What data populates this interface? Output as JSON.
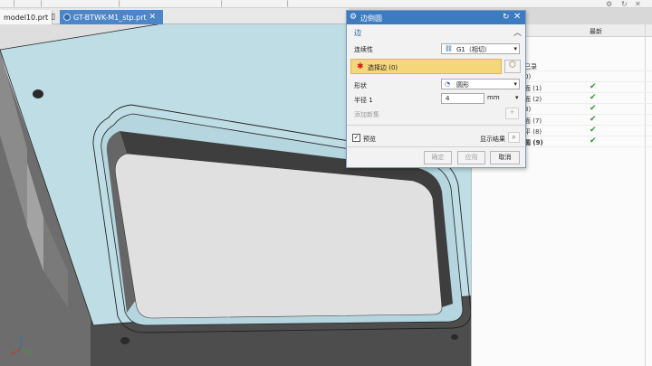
{
  "tabs": [
    {
      "label": "model10.prt",
      "active": false
    },
    {
      "label": "GT-BTWK-M1_stp.prt",
      "active": true
    }
  ],
  "dialog": {
    "title": "边倒圆",
    "section_title": "边",
    "continuity_label": "连续性",
    "continuity_value": "G1（相切）",
    "select_edge_label": "选择边 (0)",
    "shape_label": "形状",
    "shape_value": "圆形",
    "radius_label": "半径 1",
    "radius_value": "4",
    "radius_unit": "mm",
    "add_new_set_label": "添加新集",
    "preview_label": "预览",
    "preview_checked": true,
    "show_result_label": "显示结果",
    "ok_label": "确定",
    "apply_label": "应用",
    "cancel_label": "取消"
  },
  "navigator": {
    "column_latest": "最新",
    "rows": [
      {
        "label": "己录",
        "checked": false,
        "bold": false
      },
      {
        "label": "0)",
        "checked": false,
        "bold": false
      },
      {
        "label": "面 (1)",
        "checked": true,
        "bold": false
      },
      {
        "label": "面 (2)",
        "checked": true,
        "bold": false
      },
      {
        "label": "3)",
        "checked": true,
        "bold": false
      },
      {
        "label": "面 (7)",
        "checked": true,
        "bold": false
      },
      {
        "label": "平 (8)",
        "checked": true,
        "bold": false
      },
      {
        "label": "圆 (9)",
        "checked": true,
        "bold": true
      }
    ]
  },
  "colors": {
    "dialog_title_bar": "#3c7bc0",
    "active_tab": "#4a86c8",
    "selection_highlight": "#f6d67a",
    "part_face": "#bfdde5",
    "pocket_floor": "#e0e0e0",
    "check_green": "#2c9c2c"
  },
  "icons": {
    "close_tab": "close-icon",
    "page_tab": "page-icon",
    "dialog_gear": "gear-icon",
    "reset": "reset-icon",
    "close": "close-icon",
    "collapse": "chevron-up-icon",
    "continuity": "chain-icon",
    "required_marker": "asterisk-icon",
    "edge_selector": "cube-icon",
    "shape": "fillet-shape-icon",
    "dropdown": "chevron-down-icon",
    "add_set": "plus-icon",
    "show_result": "magnifier-icon",
    "checkmark": "check-icon",
    "view_triad": "axis-triad-icon"
  }
}
